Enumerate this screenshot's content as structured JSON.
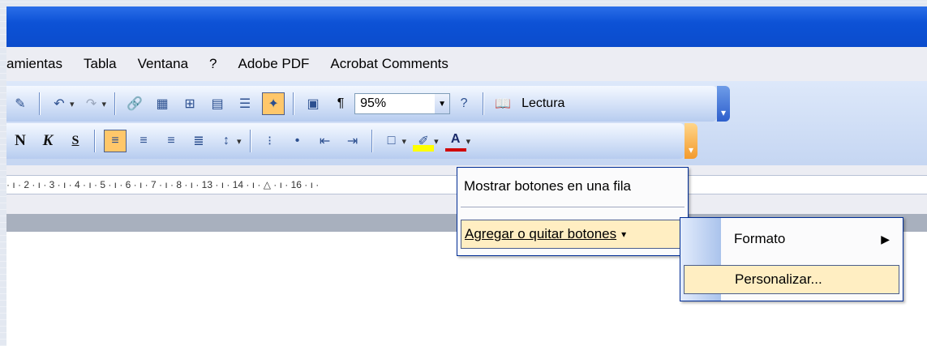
{
  "menu": {
    "items": [
      "amientas",
      "Tabla",
      "Ventana",
      "?",
      "Adobe PDF",
      "Acrobat Comments"
    ]
  },
  "toolbar1": {
    "zoom": "95%",
    "lectura": "Lectura"
  },
  "toolbar2": {
    "bold": "N",
    "italic": "K",
    "underline": "S"
  },
  "ruler": {
    "text": "· ı · 2 · ı · 3 · ı · 4 · ı · 5 · ı · 6 · ı · 7 · ı · 8 · ı ·                                                   13 · ı · 14 · ı · △ · ı · 16 · ı ·"
  },
  "context_menu": {
    "item1": "Mostrar botones en una fila",
    "item2": "Agregar o quitar botones"
  },
  "submenu": {
    "item1": "Formato",
    "item2": "Personalizar..."
  }
}
